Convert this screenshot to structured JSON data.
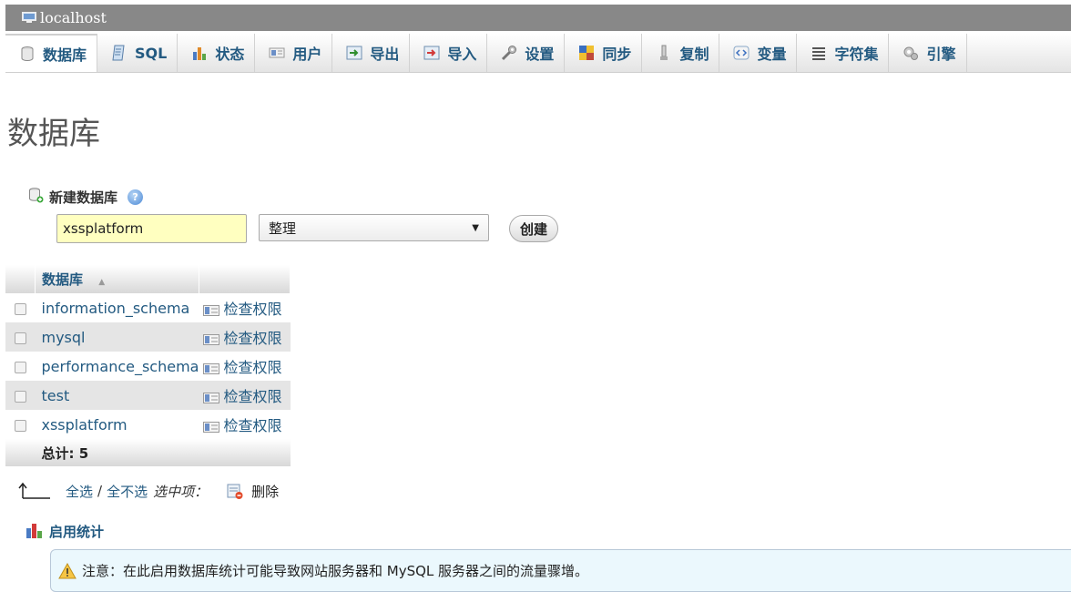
{
  "server": {
    "title": "localhost",
    "icon": "server-icon"
  },
  "tabs": [
    {
      "label": "数据库",
      "icon": "database-icon",
      "active": true
    },
    {
      "label": "SQL",
      "icon": "sql-icon"
    },
    {
      "label": "状态",
      "icon": "status-icon"
    },
    {
      "label": "用户",
      "icon": "users-icon"
    },
    {
      "label": "导出",
      "icon": "export-icon"
    },
    {
      "label": "导入",
      "icon": "import-icon"
    },
    {
      "label": "设置",
      "icon": "settings-icon"
    },
    {
      "label": "同步",
      "icon": "sync-icon"
    },
    {
      "label": "复制",
      "icon": "replication-icon"
    },
    {
      "label": "变量",
      "icon": "variables-icon"
    },
    {
      "label": "字符集",
      "icon": "charset-icon"
    },
    {
      "label": "引擎",
      "icon": "engine-icon"
    }
  ],
  "page_title": "数据库",
  "create_db": {
    "header": "新建数据库",
    "name_value": "xssplatform",
    "collation_selected": "整理",
    "create_label": "创建"
  },
  "db_table": {
    "column_header": "数据库",
    "rows": [
      {
        "name": "information_schema",
        "action": "检查权限"
      },
      {
        "name": "mysql",
        "action": "检查权限"
      },
      {
        "name": "performance_schema",
        "action": "检查权限"
      },
      {
        "name": "test",
        "action": "检查权限"
      },
      {
        "name": "xssplatform",
        "action": "检查权限"
      }
    ],
    "total_label": "总计: 5"
  },
  "bulk": {
    "select_all": "全选",
    "separator": "/",
    "deselect_all": "全不选",
    "with_selected": "选中项：",
    "delete": "删除"
  },
  "stats": {
    "label": "启用统计"
  },
  "notice": {
    "text": "注意：在此启用数据库统计可能导致网站服务器和 MySQL 服务器之间的流量骤增。"
  },
  "colors": {
    "link": "#235a81",
    "server_bar": "#888888",
    "input_bg": "#ffffc0",
    "notice_bg": "#ebf8fd"
  }
}
